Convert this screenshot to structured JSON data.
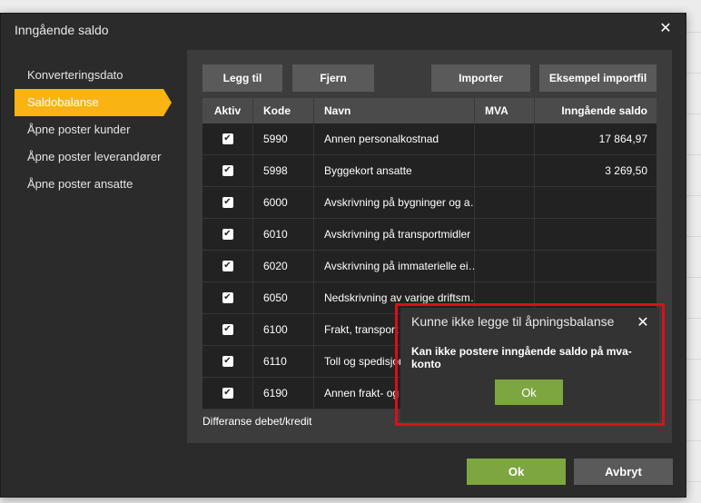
{
  "dialog": {
    "title": "Inngående saldo",
    "close_icon": "✕",
    "ok_label": "Ok",
    "cancel_label": "Avbryt"
  },
  "sidebar": {
    "items": [
      {
        "label": "Konverteringsdato",
        "active": false
      },
      {
        "label": "Saldobalanse",
        "active": true
      },
      {
        "label": "Åpne poster kunder",
        "active": false
      },
      {
        "label": "Åpne poster leverandører",
        "active": false
      },
      {
        "label": "Åpne poster ansatte",
        "active": false
      }
    ]
  },
  "toolbar": {
    "add_label": "Legg til",
    "remove_label": "Fjern",
    "import_label": "Importer",
    "example_label": "Eksempel importfil"
  },
  "grid": {
    "headers": {
      "aktiv": "Aktiv",
      "kode": "Kode",
      "navn": "Navn",
      "mva": "MVA",
      "saldo": "Inngående saldo"
    },
    "rows": [
      {
        "aktiv": true,
        "kode": "5990",
        "navn": "Annen personalkostnad",
        "mva": "",
        "saldo": "17 864,97"
      },
      {
        "aktiv": true,
        "kode": "5998",
        "navn": "Byggekort ansatte",
        "mva": "",
        "saldo": "3 269,50"
      },
      {
        "aktiv": true,
        "kode": "6000",
        "navn": "Avskrivning på bygninger og a…",
        "mva": "",
        "saldo": ""
      },
      {
        "aktiv": true,
        "kode": "6010",
        "navn": "Avskrivning på transportmidler",
        "mva": "",
        "saldo": ""
      },
      {
        "aktiv": true,
        "kode": "6020",
        "navn": "Avskrivning på immaterielle ei…",
        "mva": "",
        "saldo": ""
      },
      {
        "aktiv": true,
        "kode": "6050",
        "navn": "Nedskrivning av varige driftsm…",
        "mva": "",
        "saldo": ""
      },
      {
        "aktiv": true,
        "kode": "6100",
        "navn": "Frakt, transport",
        "mva": "",
        "saldo": ""
      },
      {
        "aktiv": true,
        "kode": "6110",
        "navn": "Toll og spedisjon",
        "mva": "",
        "saldo": ""
      },
      {
        "aktiv": true,
        "kode": "6190",
        "navn": "Annen frakt- og",
        "mva": "",
        "saldo": ""
      }
    ],
    "footer_label": "Differanse debet/kredit"
  },
  "alert": {
    "title": "Kunne ikke legge til åpningsbalanse",
    "message": "Kan ikke postere inngående saldo på mva-konto",
    "ok_label": "Ok",
    "close_icon": "✕"
  },
  "colors": {
    "accent": "#f9b312",
    "ok_green": "#7ea640",
    "alert_outline": "#d9101a"
  }
}
